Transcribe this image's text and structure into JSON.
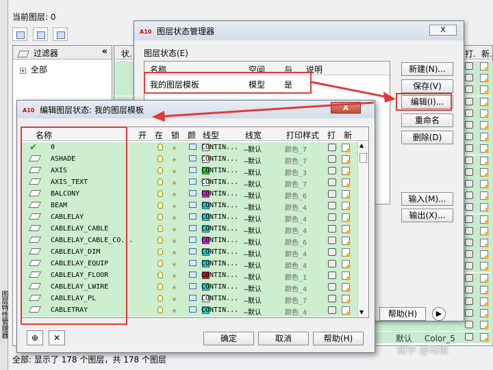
{
  "background": {
    "current_layer_label": "当前图层: 0",
    "filter_header": "过滤器",
    "filter_all": "全部",
    "col_status": "状.",
    "col_plot": "打.",
    "col_new": "新.",
    "status_text": "全部: 显示了 178 个图层，共 178 个图层",
    "side_strip_text": "图层特性管理器",
    "extra_row": {
      "lineweight": "默认",
      "color": "Color_5"
    }
  },
  "layer_states_manager": {
    "title": "图层状态管理器",
    "close_label": "X",
    "section_label": "图层状态(E)",
    "columns": {
      "name": "名称",
      "space": "空间",
      "same": "与",
      "desc": "说明"
    },
    "row": {
      "name": "我的图层模板",
      "space": "模型",
      "same": "是"
    },
    "buttons": {
      "new": "新建(N)...",
      "save": "保存(V)",
      "edit": "编辑(I)...",
      "rename": "重命名",
      "delete": "删除(D)",
      "import": "输入(M)...",
      "export": "输出(X)...",
      "help": "帮助(H)"
    }
  },
  "edit_layer_state": {
    "title": "编辑图层状态: 我的图层模板",
    "close_label": "X",
    "columns": {
      "name": "名称",
      "on": "开",
      "freeze": "在",
      "lock": "锁",
      "color": "颜",
      "linetype": "线型",
      "lineweight": "线宽",
      "plotstyle": "打印样式",
      "plot": "打",
      "new": "新"
    },
    "layers": [
      {
        "name": "0",
        "current": true,
        "color": "#ffffff",
        "linetype": "CONTIN...",
        "lineweight": "—默认",
        "plotstyle": "颜色_7"
      },
      {
        "name": "ASHADE",
        "current": false,
        "color": "#ffffff",
        "linetype": "CONTIN...",
        "lineweight": "—默认",
        "plotstyle": "颜色_7"
      },
      {
        "name": "AXIS",
        "current": false,
        "color": "#22cc22",
        "linetype": "CONTIN...",
        "lineweight": "—默认",
        "plotstyle": "颜色_3"
      },
      {
        "name": "AXIS_TEXT",
        "current": false,
        "color": "#ffffff",
        "linetype": "CONTIN...",
        "lineweight": "—默认",
        "plotstyle": "颜色_7"
      },
      {
        "name": "BALCONY",
        "current": false,
        "color": "#cc22cc",
        "linetype": "CONTIN...",
        "lineweight": "—默认",
        "plotstyle": "颜色_6"
      },
      {
        "name": "BEAM",
        "current": false,
        "color": "#22cccc",
        "linetype": "CONTIN...",
        "lineweight": "—默认",
        "plotstyle": "颜色_4"
      },
      {
        "name": "CABLELAY",
        "current": false,
        "color": "#22cccc",
        "linetype": "CONTIN...",
        "lineweight": "—默认",
        "plotstyle": "颜色_4"
      },
      {
        "name": "CABLELAY_CABLE",
        "current": false,
        "color": "#22cccc",
        "linetype": "CONTIN...",
        "lineweight": "—默认",
        "plotstyle": "颜色_4"
      },
      {
        "name": "CABLELAY_CABLE_CO...",
        "current": false,
        "color": "#cc22cc",
        "linetype": "CONTIN...",
        "lineweight": "—默认",
        "plotstyle": "颜色_6"
      },
      {
        "name": "CABLELAY_DIM",
        "current": false,
        "color": "#22cccc",
        "linetype": "CONTIN...",
        "lineweight": "—默认",
        "plotstyle": "颜色_4"
      },
      {
        "name": "CABLELAY_EQUIP",
        "current": false,
        "color": "#22cccc",
        "linetype": "CONTIN...",
        "lineweight": "—默认",
        "plotstyle": "颜色_4"
      },
      {
        "name": "CABLELAY_FLOOR",
        "current": false,
        "color": "#cc1111",
        "linetype": "CONTIN...",
        "lineweight": "—默认",
        "plotstyle": "颜色_1"
      },
      {
        "name": "CABLELAY_LWIRE",
        "current": false,
        "color": "#22cccc",
        "linetype": "CONTIN...",
        "lineweight": "—默认",
        "plotstyle": "颜色_4"
      },
      {
        "name": "CABLELAY_PL",
        "current": false,
        "color": "#ffffff",
        "linetype": "CONTIN...",
        "lineweight": "—默认",
        "plotstyle": "颜色_7"
      },
      {
        "name": "CABLETRAY",
        "current": false,
        "color": "#22cccc",
        "linetype": "CONTIN...",
        "lineweight": "—默认",
        "plotstyle": "颜色_4"
      }
    ],
    "buttons": {
      "ok": "确定",
      "cancel": "取消",
      "help": "帮助(H)"
    }
  },
  "watermark": "知乎 @马锐"
}
